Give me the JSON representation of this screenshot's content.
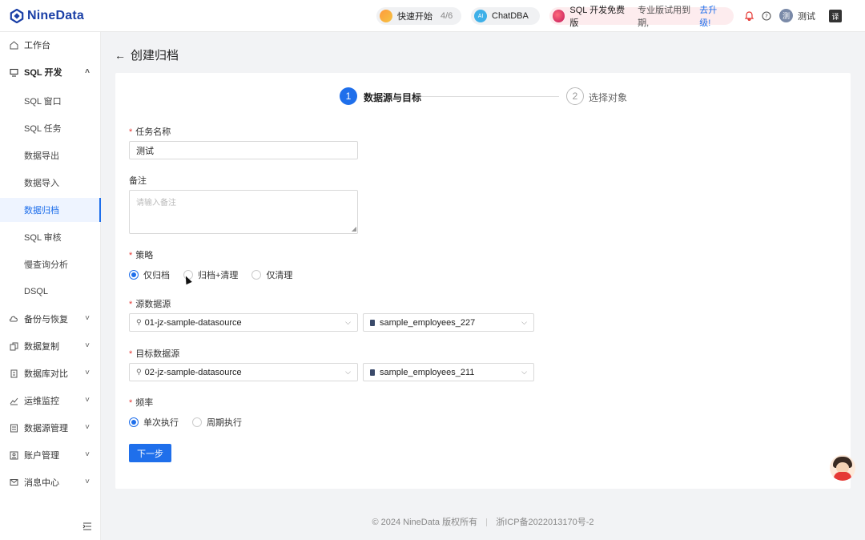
{
  "app": {
    "name": "NineData"
  },
  "topbar": {
    "quick_start": {
      "label": "快速开始",
      "count": "4/6"
    },
    "chatdba": {
      "label": "ChatDBA",
      "badge": "AI"
    },
    "promo": {
      "title": "SQL 开发免费版",
      "text": "专业版试用到期,",
      "link": "去升级!"
    },
    "user": {
      "name": "测试",
      "avatar": "测"
    },
    "lang": "译"
  },
  "sidebar": {
    "items": [
      {
        "label": "工作台",
        "icon": "home-icon"
      },
      {
        "label": "SQL 开发",
        "icon": "monitor-icon",
        "expanded": true
      },
      {
        "label": "备份与恢复",
        "icon": "cloud-icon"
      },
      {
        "label": "数据复制",
        "icon": "copy-icon"
      },
      {
        "label": "数据库对比",
        "icon": "compare-icon"
      },
      {
        "label": "运维监控",
        "icon": "monitor-icon"
      },
      {
        "label": "数据源管理",
        "icon": "datasource-icon"
      },
      {
        "label": "账户管理",
        "icon": "account-icon"
      },
      {
        "label": "消息中心",
        "icon": "mail-icon"
      }
    ],
    "sub_items": [
      "SQL 窗口",
      "SQL 任务",
      "数据导出",
      "数据导入",
      "数据归档",
      "SQL 审核",
      "慢查询分析",
      "DSQL"
    ],
    "active": "数据归档"
  },
  "page": {
    "title": "创建归档"
  },
  "steps": [
    {
      "num": "1",
      "label": "数据源与目标",
      "active": true
    },
    {
      "num": "2",
      "label": "选择对象",
      "active": false
    }
  ],
  "form": {
    "task_name": {
      "label": "任务名称",
      "value": "测试"
    },
    "remark": {
      "label": "备注",
      "placeholder": "请输入备注"
    },
    "strategy": {
      "label": "策略",
      "options": [
        "仅归档",
        "归档+清理",
        "仅清理"
      ],
      "selected": "仅归档"
    },
    "source": {
      "label": "源数据源",
      "datasource": "01-jz-sample-datasource",
      "database": "sample_employees_227"
    },
    "target": {
      "label": "目标数据源",
      "datasource": "02-jz-sample-datasource",
      "database": "sample_employees_211"
    },
    "frequency": {
      "label": "频率",
      "options": [
        "单次执行",
        "周期执行"
      ],
      "selected": "单次执行"
    },
    "next_label": "下一步"
  },
  "footer": {
    "copyright": "© 2024 NineData 版权所有",
    "icp": "浙ICP备2022013170号-2"
  }
}
